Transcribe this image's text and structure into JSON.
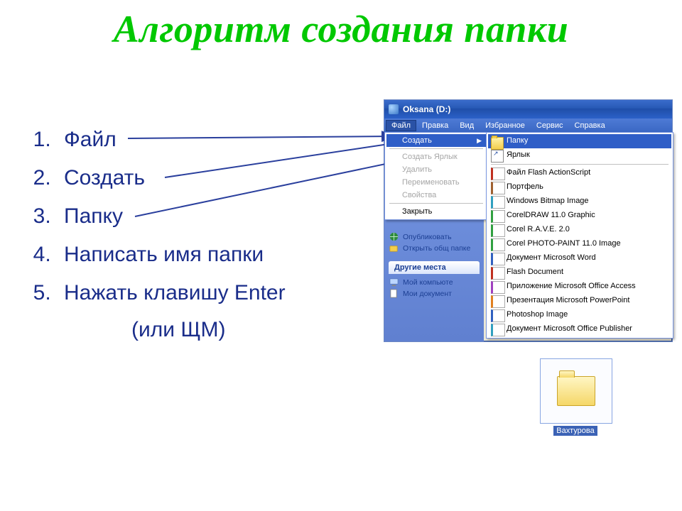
{
  "title": "Алгоритм создания папки",
  "steps": [
    "Файл",
    "Создать",
    "Папку",
    "Написать имя папки",
    "Нажать клавишу Enter"
  ],
  "step5_tail": "(или ЩМ)",
  "explorer": {
    "window_title": "Oksana (D:)",
    "menubar": [
      "Файл",
      "Правка",
      "Вид",
      "Избранное",
      "Сервис",
      "Справка"
    ],
    "file_menu": {
      "create": "Создать",
      "create_shortcut": "Создать Ярлык",
      "delete": "Удалить",
      "rename": "Переименовать",
      "properties": "Свойства",
      "close": "Закрыть"
    },
    "create_submenu": [
      "Папку",
      "Ярлык",
      "Файл Flash ActionScript",
      "Портфель",
      "Windows Bitmap Image",
      "CorelDRAW 11.0 Graphic",
      "Corel R.A.V.E. 2.0",
      "Corel PHOTO-PAINT 11.0 Image",
      "Документ Microsoft Word",
      "Flash Document",
      "Приложение Microsoft Office Access",
      "Презентация Microsoft PowerPoint",
      "Photoshop Image",
      "Документ Microsoft Office Publisher"
    ],
    "tasks": {
      "publish": "Опубликовать",
      "share": "Открыть общ папке"
    },
    "other_places_header": "Другие места",
    "other_places": [
      "Мой компьюте",
      "Мои документ"
    ]
  },
  "new_folder_label": "Вахтурова"
}
